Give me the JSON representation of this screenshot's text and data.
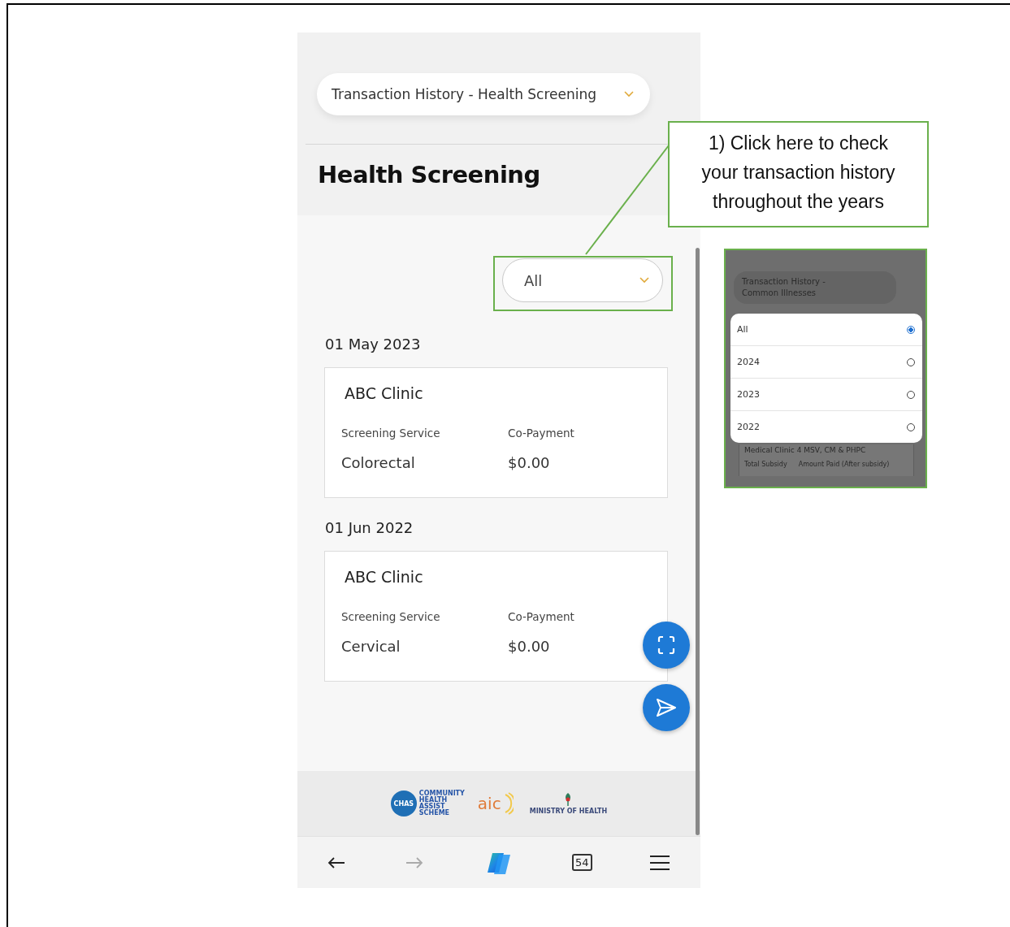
{
  "phone": {
    "category_dropdown": {
      "value": "Transaction History - Health Screening"
    },
    "title": "Health Screening",
    "year_filter": {
      "value": "All"
    },
    "transactions": [
      {
        "date": "01 May 2023",
        "clinic": "ABC Clinic",
        "fields": [
          {
            "label": "Screening Service",
            "value": "Colorectal"
          },
          {
            "label": "Co-Payment",
            "value": "$0.00"
          }
        ]
      },
      {
        "date": "01 Jun 2022",
        "clinic": "ABC Clinic",
        "fields": [
          {
            "label": "Screening Service",
            "value": "Cervical"
          },
          {
            "label": "Co-Payment",
            "value": "$0.00"
          }
        ]
      }
    ],
    "footer_logos": [
      {
        "kind": "chas",
        "mark": "CHAS",
        "caption": "COMMUNITY HEALTH ASSIST SCHEME"
      },
      {
        "kind": "aic",
        "mark": "aic"
      },
      {
        "kind": "moh",
        "caption": "MINISTRY OF HEALTH"
      }
    ],
    "browser_nav": {
      "tab_count": "54"
    }
  },
  "callout": {
    "text": "1) Click here to check your transaction history throughout the years"
  },
  "inset": {
    "header": "Transaction History - Common Illnesses",
    "options": [
      {
        "label": "All",
        "selected": true
      },
      {
        "label": "2024",
        "selected": false
      },
      {
        "label": "2023",
        "selected": false
      },
      {
        "label": "2022",
        "selected": false
      }
    ],
    "clinic": "Medical Clinic 4 MSV, CM & PHPC",
    "labels": [
      "Total Subsidy",
      "Amount Paid (After subsidy)"
    ]
  }
}
